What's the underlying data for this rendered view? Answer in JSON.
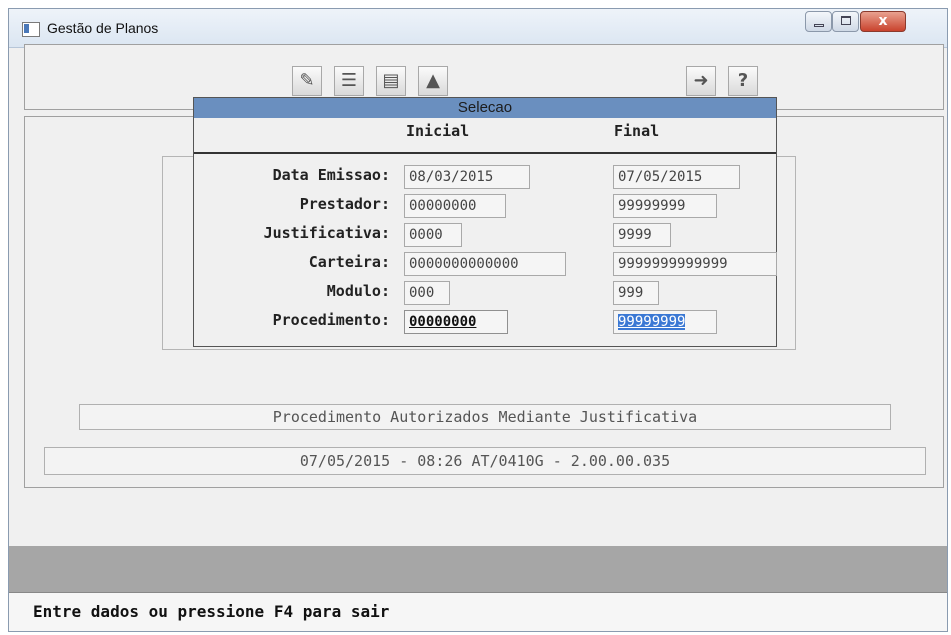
{
  "window": {
    "title": "Gestão de Planos",
    "close_glyph": "x"
  },
  "toolbar": {
    "icons": [
      "edit-icon",
      "list-icon",
      "detail-icon",
      "print-icon",
      "exit-icon",
      "help-icon"
    ],
    "help_glyph": "?"
  },
  "dialog": {
    "title": "Selecao",
    "col_inicial": "Inicial",
    "col_final": "Final",
    "rows": [
      {
        "label": "Data Emissao:",
        "inicial": "08/03/2015",
        "final": "07/05/2015"
      },
      {
        "label": "Prestador:",
        "inicial": "00000000",
        "final": "99999999"
      },
      {
        "label": "Justificativa:",
        "inicial": "0000",
        "final": "9999"
      },
      {
        "label": "Carteira:",
        "inicial": "0000000000000",
        "final": "9999999999999"
      },
      {
        "label": "Modulo:",
        "inicial": "000",
        "final": "999"
      },
      {
        "label": "Procedimento:",
        "inicial": "00000000",
        "final": "99999999"
      }
    ]
  },
  "program_title": "Procedimento Autorizados Mediante Justificativa",
  "status_line": "07/05/2015 - 08:26  AT/0410G - 2.00.00.035",
  "prompt": "Entre dados ou pressione F4 para sair",
  "colors": {
    "dialog_title_bg": "#6a8fbf",
    "selection": "#3a78d4",
    "gray_bar": "#a6a6a6"
  }
}
